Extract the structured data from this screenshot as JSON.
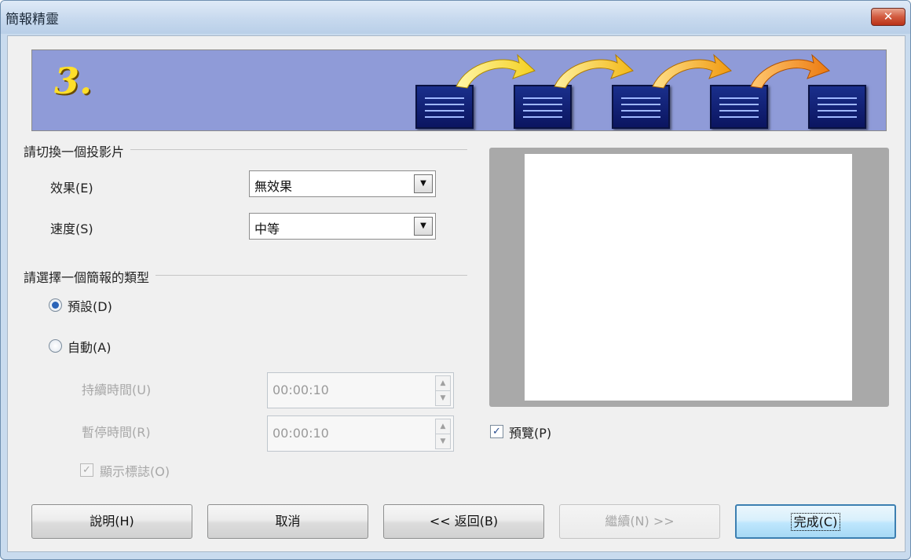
{
  "window": {
    "title": "簡報精靈",
    "close_icon": "close-icon"
  },
  "banner": {
    "step_number": "3."
  },
  "transition": {
    "group_label": "請切換一個投影片",
    "effect_label": "效果(E)",
    "effect_value": "無效果",
    "speed_label": "速度(S)",
    "speed_value": "中等"
  },
  "presentation_type": {
    "group_label": "請選擇一個簡報的類型",
    "default_label": "預設(D)",
    "default_checked": true,
    "auto_label": "自動(A)",
    "auto_checked": false,
    "duration_label": "持續時間(U)",
    "duration_value": "00:00:10",
    "pause_label": "暫停時間(R)",
    "pause_value": "00:00:10",
    "show_logo_label": "顯示標誌(O)",
    "show_logo_checked": true
  },
  "preview": {
    "label": "預覽(P)",
    "checked": true
  },
  "buttons": {
    "help": "說明(H)",
    "cancel": "取消",
    "back": "<< 返回(B)",
    "next": "繼續(N) >>",
    "finish": "完成(C)"
  }
}
